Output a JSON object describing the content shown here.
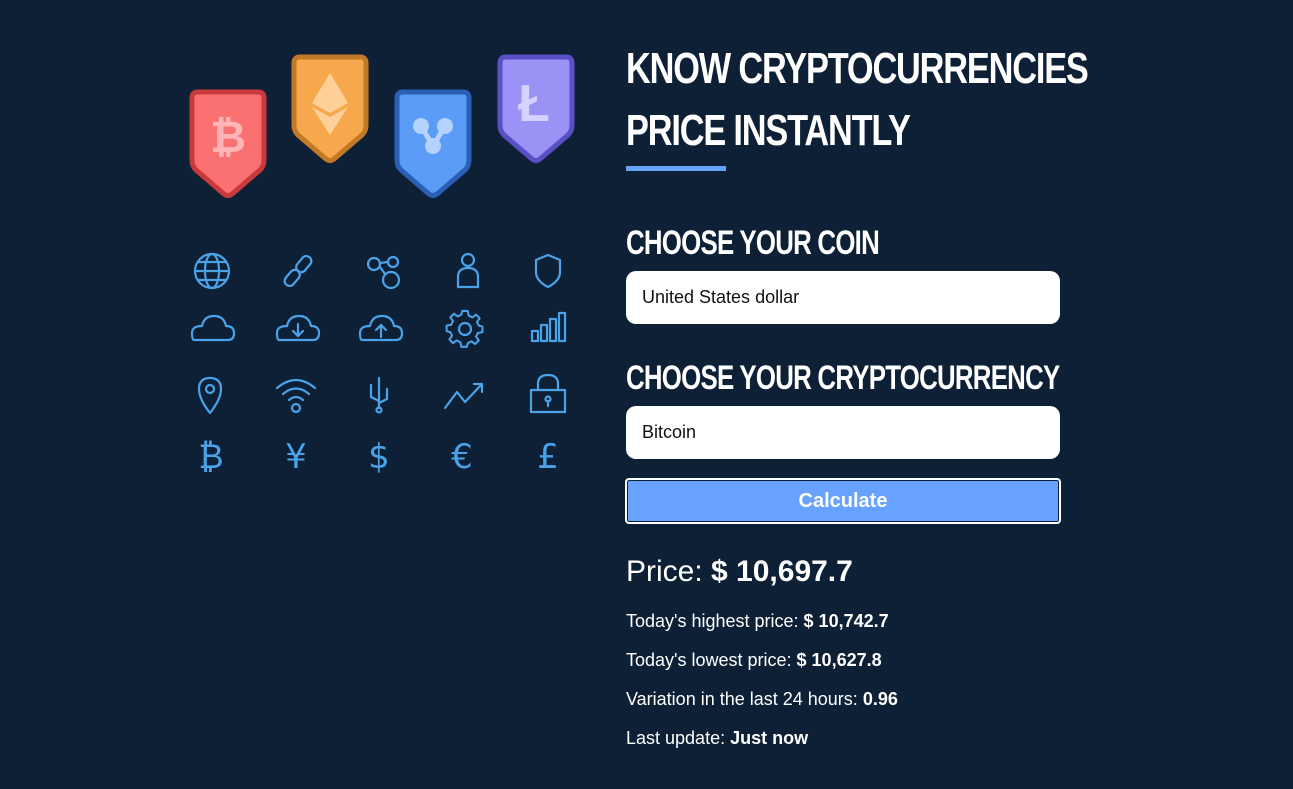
{
  "headline": {
    "line1": "KNOW CRYPTOCURRENCIES",
    "line2": "PRICE INSTANTLY"
  },
  "form": {
    "coin_label": "CHOOSE YOUR COIN",
    "coin_value": "United States dollar",
    "crypto_label": "CHOOSE YOUR CRYPTOCURRENCY",
    "crypto_value": "Bitcoin",
    "calculate_label": "Calculate"
  },
  "result": {
    "price_label": "Price:",
    "price_value": "$ 10,697.7",
    "high_label": "Today's highest price:",
    "high_value": "$ 10,742.7",
    "low_label": "Today's lowest price:",
    "low_value": "$ 10,627.8",
    "variation_label": "Variation in the last 24 hours:",
    "variation_value": "0.96",
    "update_label": "Last update:",
    "update_value": "Just now"
  },
  "illustration": {
    "badges": [
      "bitcoin-icon",
      "ethereum-icon",
      "ripple-icon",
      "litecoin-icon"
    ],
    "icons": [
      "globe-icon",
      "link-icon",
      "network-icon",
      "user-icon",
      "shield-icon",
      "cloud-icon",
      "cloud-download-icon",
      "cloud-upload-icon",
      "gear-icon",
      "bar-chart-icon",
      "location-pin-icon",
      "wifi-icon",
      "usb-icon",
      "trend-up-icon",
      "lock-icon",
      "bitcoin-symbol-icon",
      "yen-icon",
      "dollar-icon",
      "euro-icon",
      "pound-icon"
    ],
    "currency_symbols": [
      "₿",
      "¥",
      "$",
      "€",
      "£"
    ]
  },
  "colors": {
    "background": "#0e2036",
    "accent": "#66a2fe",
    "icon_line": "#4aa3e8",
    "bitcoin": "#fa7171",
    "ethereum": "#f7a84c",
    "ripple": "#5b9cf7",
    "litecoin": "#9a92f5"
  }
}
